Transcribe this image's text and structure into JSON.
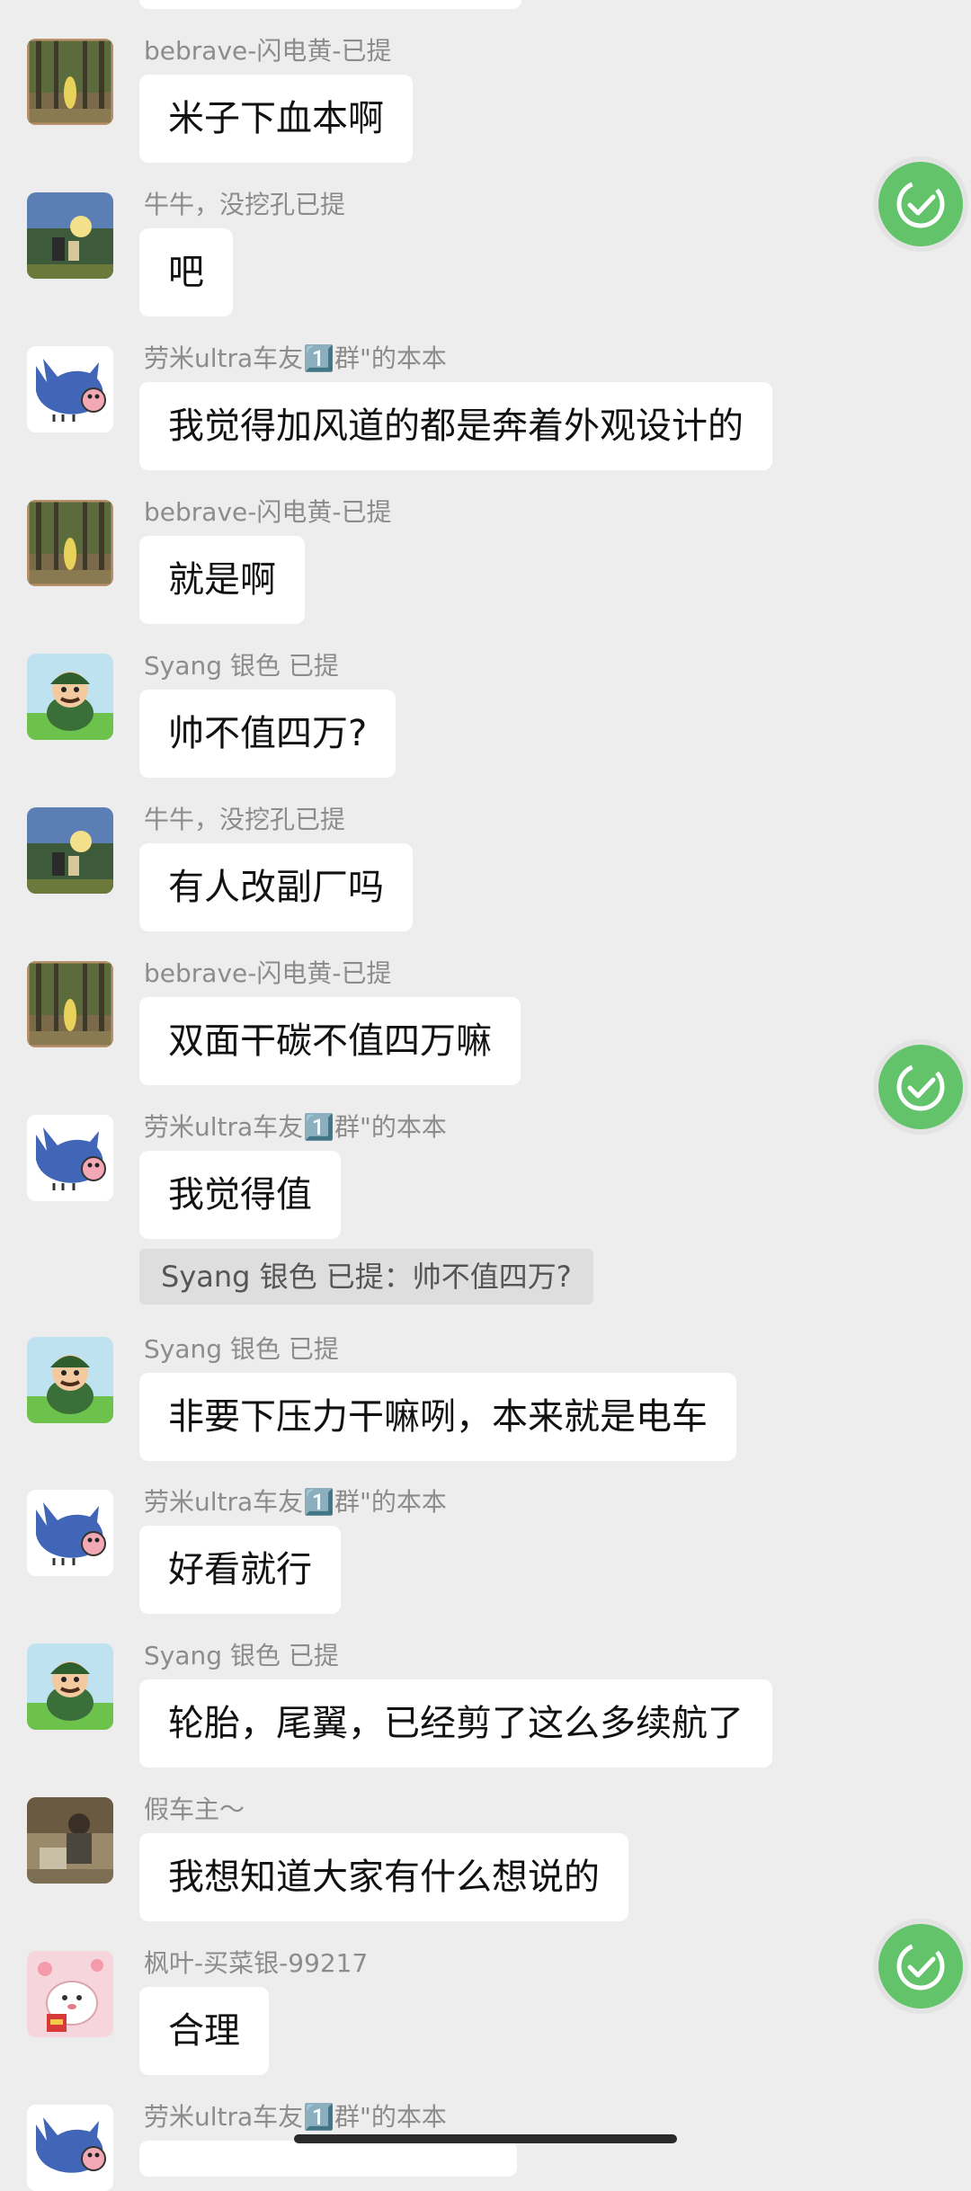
{
  "messages": [
    {
      "sender": "bebrave-闪电黄-已提",
      "text": "米子下血本啊"
    },
    {
      "sender": "牛牛，没挖孔已提",
      "text": "吧"
    },
    {
      "sender": "劳米ultra车友1️⃣群\"的本本",
      "text": "我觉得加风道的都是奔着外观设计的"
    },
    {
      "sender": "bebrave-闪电黄-已提",
      "text": "就是啊"
    },
    {
      "sender": "Syang  银色 已提",
      "text": "帅不值四万?"
    },
    {
      "sender": "牛牛，没挖孔已提",
      "text": "有人改副厂吗"
    },
    {
      "sender": "bebrave-闪电黄-已提",
      "text": "双面干碳不值四万嘛"
    },
    {
      "sender": "劳米ultra车友1️⃣群\"的本本",
      "text": "我觉得值"
    },
    {
      "sender": "Syang  银色 已提",
      "text": "非要下压力干嘛咧，本来就是电车"
    },
    {
      "sender": "劳米ultra车友1️⃣群\"的本本",
      "text": "好看就行"
    },
    {
      "sender": "Syang  银色 已提",
      "text": "轮胎，尾翼，已经剪了这么多续航了"
    },
    {
      "sender": "假车主～",
      "text": "我想知道大家有什么想说的"
    },
    {
      "sender": "枫叶-买菜银-99217",
      "text": "合理"
    },
    {
      "sender": "劳米ultra车友1️⃣群\"的本本",
      "text": ""
    }
  ],
  "quote": {
    "text": "Syang  银色 已提：帅不值四万?"
  },
  "colors": {
    "background": "#ededed",
    "bubble": "#ffffff",
    "sender": "#8c8c8c",
    "fab": "#62c36a"
  },
  "icons": {
    "fab": "check-circle-icon"
  }
}
